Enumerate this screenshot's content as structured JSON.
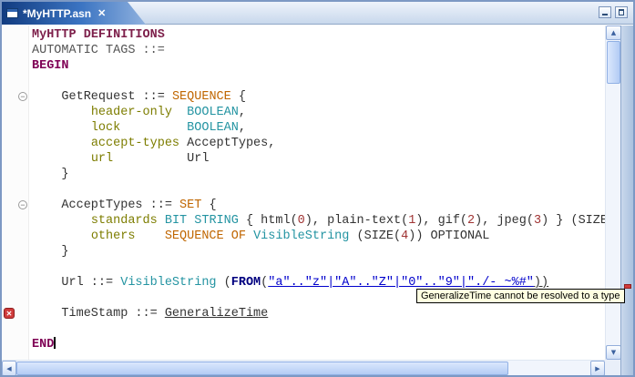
{
  "tab": {
    "title": "*MyHTTP.asn"
  },
  "icons": {
    "close": "✕",
    "scroll_up": "▲",
    "scroll_down": "▼",
    "scroll_left": "◀",
    "scroll_right": "▶",
    "fold_collapse": "−",
    "error": "✕"
  },
  "editor": {
    "tooltip": {
      "text": "GeneralizeTime cannot be resolved to a type"
    },
    "fold_marker_lines": [
      5,
      12
    ],
    "error_marker_lines": [
      19
    ],
    "syntax_colors": {
      "mod": "#7d1f4a",
      "kw": "#7F0055",
      "kwb": "#00007f",
      "dim": "#555555",
      "plain": "#333333",
      "tkw": "#c06600",
      "field": "#7d7d00",
      "bty": "#2494a2",
      "uref": "#333333",
      "str": "#0000cc",
      "num": "#a03333"
    },
    "lines": [
      {
        "tokens": [
          {
            "t": "MyHTTP",
            "c": "mod"
          },
          {
            "t": " ",
            "c": "plain"
          },
          {
            "t": "DEFINITIONS",
            "c": "mod"
          }
        ]
      },
      {
        "tokens": [
          {
            "t": "AUTOMATIC TAGS ::=",
            "c": "dim"
          }
        ]
      },
      {
        "tokens": [
          {
            "t": "BEGIN",
            "c": "kw"
          }
        ]
      },
      {
        "tokens": []
      },
      {
        "tokens": [
          {
            "t": "    GetRequest ::= ",
            "c": "plain"
          },
          {
            "t": "SEQUENCE",
            "c": "tkw"
          },
          {
            "t": " {",
            "c": "plain"
          }
        ]
      },
      {
        "tokens": [
          {
            "t": "        ",
            "c": "plain"
          },
          {
            "t": "header-only",
            "c": "field"
          },
          {
            "t": "  ",
            "c": "plain"
          },
          {
            "t": "BOOLEAN",
            "c": "bty"
          },
          {
            "t": ",",
            "c": "plain"
          }
        ]
      },
      {
        "tokens": [
          {
            "t": "        ",
            "c": "plain"
          },
          {
            "t": "lock",
            "c": "field"
          },
          {
            "t": "         ",
            "c": "plain"
          },
          {
            "t": "BOOLEAN",
            "c": "bty"
          },
          {
            "t": ",",
            "c": "plain"
          }
        ]
      },
      {
        "tokens": [
          {
            "t": "        ",
            "c": "plain"
          },
          {
            "t": "accept-types",
            "c": "field"
          },
          {
            "t": " ",
            "c": "plain"
          },
          {
            "t": "AcceptTypes",
            "c": "uref"
          },
          {
            "t": ",",
            "c": "plain"
          }
        ]
      },
      {
        "tokens": [
          {
            "t": "        ",
            "c": "plain"
          },
          {
            "t": "url",
            "c": "field"
          },
          {
            "t": "          ",
            "c": "plain"
          },
          {
            "t": "Url",
            "c": "uref"
          }
        ]
      },
      {
        "tokens": [
          {
            "t": "    }",
            "c": "plain"
          }
        ]
      },
      {
        "tokens": []
      },
      {
        "tokens": [
          {
            "t": "    AcceptTypes ::= ",
            "c": "plain"
          },
          {
            "t": "SET",
            "c": "tkw"
          },
          {
            "t": " {",
            "c": "plain"
          }
        ]
      },
      {
        "tokens": [
          {
            "t": "        ",
            "c": "plain"
          },
          {
            "t": "standards",
            "c": "field"
          },
          {
            "t": " ",
            "c": "plain"
          },
          {
            "t": "BIT STRING",
            "c": "bty"
          },
          {
            "t": " { html(",
            "c": "plain"
          },
          {
            "t": "0",
            "c": "num"
          },
          {
            "t": "), plain-text(",
            "c": "plain"
          },
          {
            "t": "1",
            "c": "num"
          },
          {
            "t": "), gif(",
            "c": "plain"
          },
          {
            "t": "2",
            "c": "num"
          },
          {
            "t": "), jpeg(",
            "c": "plain"
          },
          {
            "t": "3",
            "c": "num"
          },
          {
            "t": ") } (SIZE(",
            "c": "plain"
          }
        ]
      },
      {
        "tokens": [
          {
            "t": "        ",
            "c": "plain"
          },
          {
            "t": "others",
            "c": "field"
          },
          {
            "t": "    ",
            "c": "plain"
          },
          {
            "t": "SEQUENCE OF",
            "c": "tkw"
          },
          {
            "t": " ",
            "c": "plain"
          },
          {
            "t": "VisibleString",
            "c": "bty"
          },
          {
            "t": " (SIZE(",
            "c": "plain"
          },
          {
            "t": "4",
            "c": "num"
          },
          {
            "t": ")) OPTIONAL",
            "c": "plain"
          }
        ]
      },
      {
        "tokens": [
          {
            "t": "    }",
            "c": "plain"
          }
        ]
      },
      {
        "tokens": []
      },
      {
        "tokens": [
          {
            "t": "    Url ::= ",
            "c": "plain"
          },
          {
            "t": "VisibleString",
            "c": "bty"
          },
          {
            "t": " (",
            "c": "plain"
          },
          {
            "t": "FROM",
            "c": "kwb"
          },
          {
            "t": "(",
            "c": "plain"
          },
          {
            "t": "\"a\"..\"z\"|\"A\"..\"Z\"|\"0\"..\"9\"|\"./-_~%#\"",
            "c": "str u"
          },
          {
            "t": "))",
            "c": "plain u"
          }
        ]
      },
      {
        "tokens": []
      },
      {
        "tokens": [
          {
            "t": "    TimeStamp ::= ",
            "c": "plain"
          },
          {
            "t": "GeneralizeTime",
            "c": "uref u"
          }
        ]
      },
      {
        "tokens": []
      },
      {
        "tokens": [
          {
            "t": "END",
            "c": "kw"
          }
        ],
        "caret": true
      }
    ]
  }
}
